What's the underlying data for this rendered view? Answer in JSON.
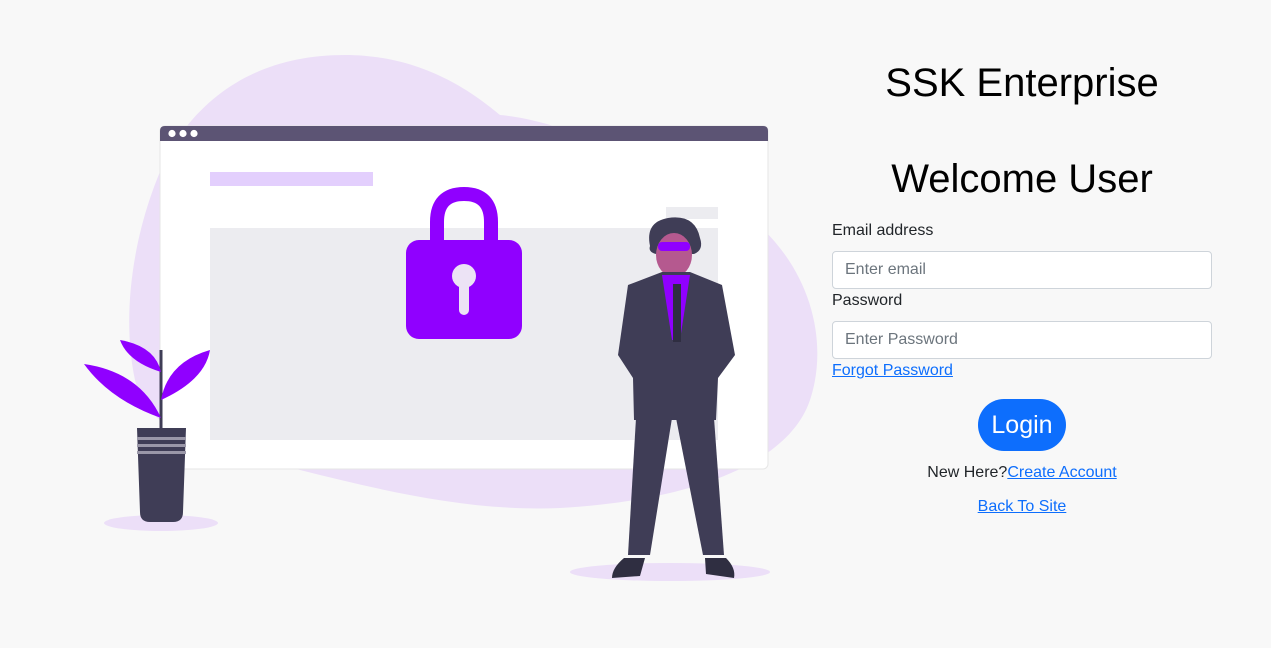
{
  "brand": {
    "title": "SSK Enterprise"
  },
  "welcome": {
    "title": "Welcome User"
  },
  "form": {
    "email_label": "Email address",
    "email_placeholder": "Enter email",
    "email_value": "",
    "password_label": "Password",
    "password_placeholder": "Enter Password",
    "password_value": "",
    "forgot_label": "Forgot Password",
    "login_label": "Login"
  },
  "footer": {
    "new_here_text": "New Here?",
    "create_account_label": "Create Account",
    "back_to_site_label": "Back To Site"
  },
  "colors": {
    "accent": "#0d6efd",
    "illustration_purple": "#9000ff",
    "illustration_dark": "#3f3d56"
  },
  "illustration": {
    "subject": "login-security-illustration"
  }
}
